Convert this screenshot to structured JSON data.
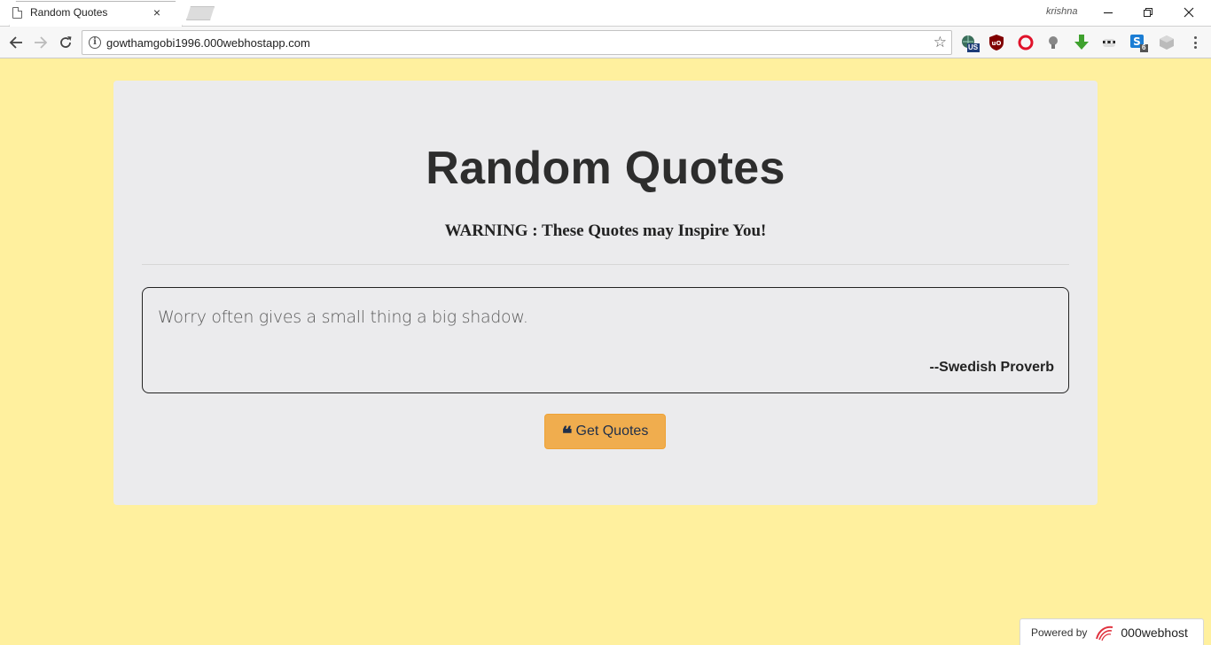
{
  "browser": {
    "tab_title": "Random Quotes",
    "tab_close": "×",
    "profile_name": "krishna",
    "url": "gowthamgobi1996.000webhostapp.com",
    "extensions": [
      "vpn-globe-icon",
      "ublock-icon",
      "opera-icon",
      "lightbulb-icon",
      "download-arrow-icon",
      "incognito-mask-icon",
      "skype-icon",
      "gray-extension-icon"
    ],
    "ext_badges": {
      "vpn": "US",
      "skype": "6"
    }
  },
  "page": {
    "title": "Random Quotes",
    "warning": "WARNING : These Quotes may Inspire You!",
    "quote": {
      "text": "Worry often gives a small thing a big shadow.",
      "author": "--Swedish Proverb"
    },
    "button_label": "Get Quotes",
    "button_icon_glyph": "❝",
    "background_color": "#fff09e",
    "card_color": "#ebebed",
    "button_color": "#f0ad4e"
  },
  "footer": {
    "powered_by": "Powered by",
    "brand": "000webhost"
  }
}
